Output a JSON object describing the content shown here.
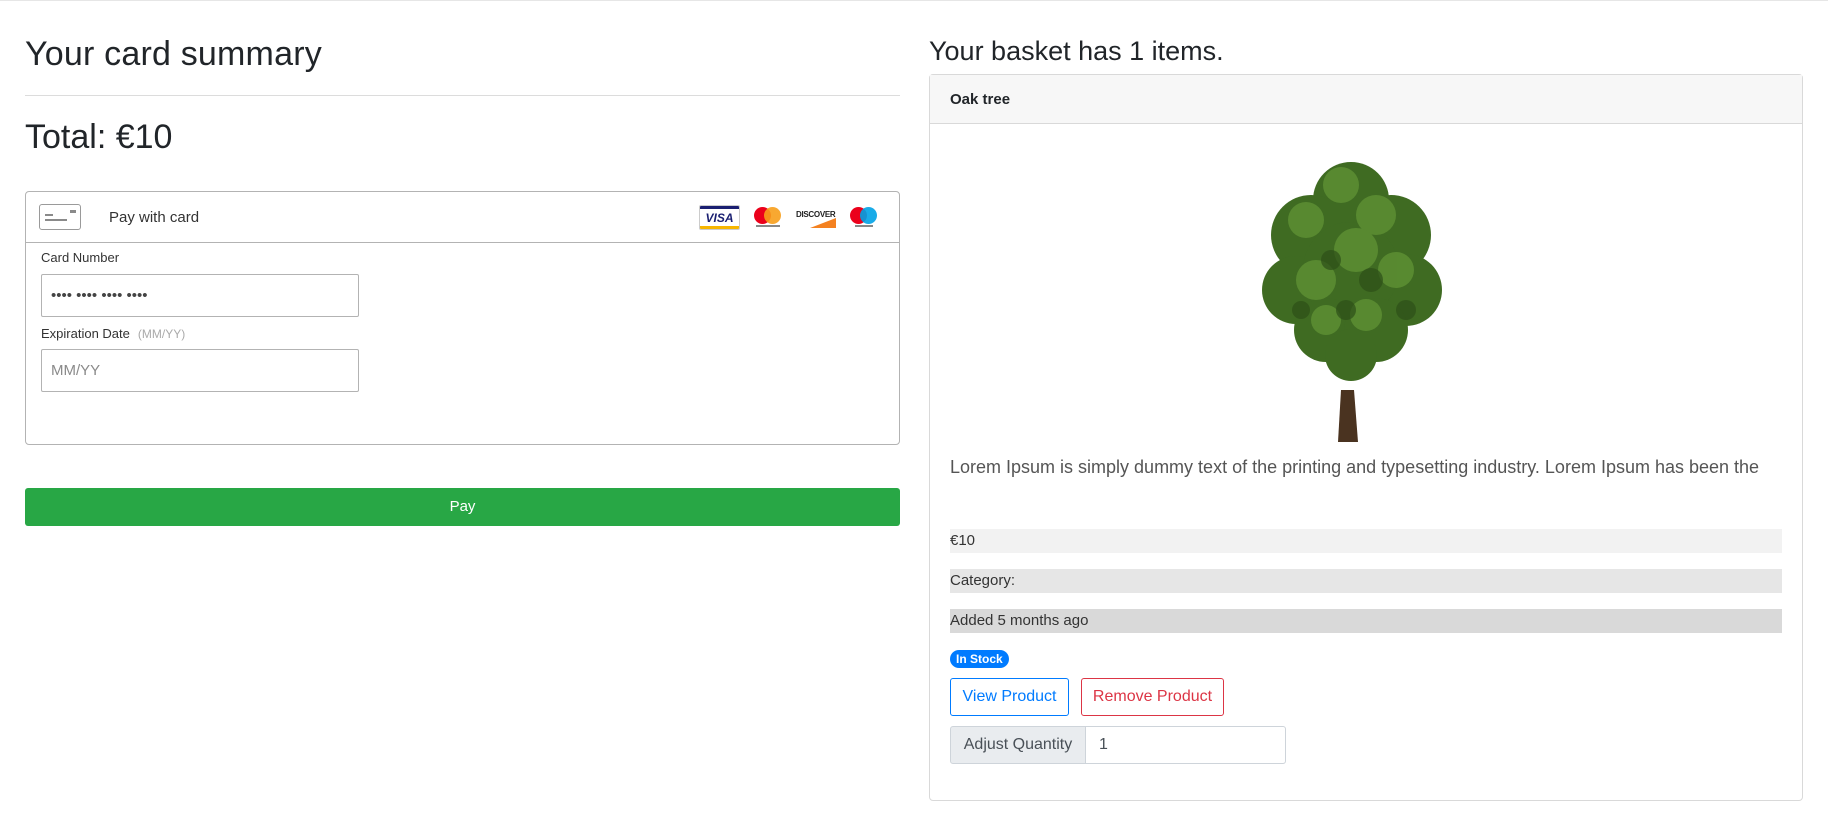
{
  "summary": {
    "title": "Your card summary",
    "total": "Total: €10"
  },
  "payment": {
    "pay_with_label": "Pay with card",
    "card_icon": "credit-card-icon",
    "brands": [
      "VISA",
      "mastercard",
      "DISCOVER",
      "maestro"
    ],
    "card_number_label": "Card Number",
    "card_number_value": "•••• •••• •••• ••••",
    "expiration_label": "Expiration Date",
    "expiration_hint": "(MM/YY)",
    "expiration_placeholder": "MM/YY",
    "pay_button": "Pay",
    "pay_button_color": "#28a745"
  },
  "basket": {
    "title": "Your basket has 1 items.",
    "product": {
      "name": "Oak tree",
      "image": "oak-tree-image",
      "description": "Lorem Ipsum is simply dummy text of the printing and typesetting industry. Lorem Ipsum has been the",
      "price": "€10",
      "category": "Category:",
      "added": "Added 5 months ago",
      "stock_badge": "In Stock",
      "view_button": "View Product",
      "remove_button": "Remove Product",
      "quantity_label": "Adjust Quantity",
      "quantity_value": "1"
    }
  },
  "colors": {
    "primary": "#007bff",
    "danger": "#dc3545",
    "success": "#28a745"
  }
}
